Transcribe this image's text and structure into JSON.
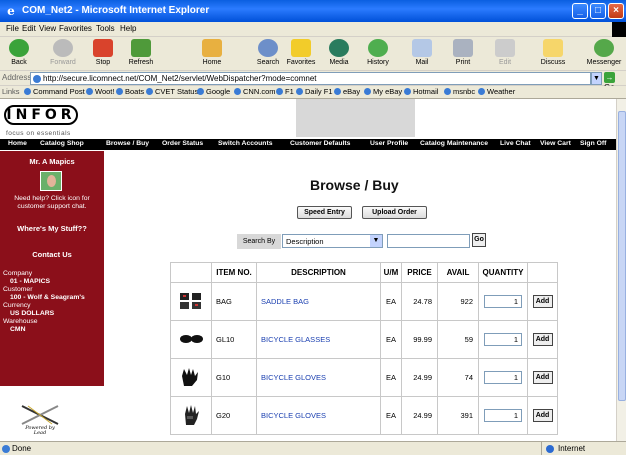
{
  "window": {
    "title": "COM_Net2 - Microsoft Internet Explorer"
  },
  "menu": [
    "File",
    "Edit",
    "View",
    "Favorites",
    "Tools",
    "Help"
  ],
  "toolbar": {
    "back": "Back",
    "forward": "Forward",
    "stop": "Stop",
    "refresh": "Refresh",
    "home": "Home",
    "search": "Search",
    "favorites": "Favorites",
    "media": "Media",
    "history": "History",
    "mail": "Mail",
    "print": "Print",
    "edit": "Edit",
    "discuss": "Discuss",
    "messenger": "Messenger"
  },
  "address": {
    "label": "Address",
    "url": "http://secure.licomnect.net/COM_Net2/servlet/WebDispatcher?mode=comnet",
    "go": "Go"
  },
  "links": {
    "label": "Links",
    "items": [
      "Command Post",
      "Woot!",
      "Boats",
      "CVET Status",
      "Google",
      "CNN.com",
      "F1",
      "Daily F1",
      "eBay",
      "My eBay",
      "Hotmail",
      "msnbc",
      "Weather"
    ]
  },
  "header": {
    "logo": "INFOR",
    "tagline": "focus on essentials",
    "nav": [
      "Home",
      "Catalog Shop",
      "Browse / Buy",
      "Order Status",
      "Switch Accounts",
      "Customer Defaults",
      "User Profile",
      "Catalog Maintenance",
      "Live Chat",
      "View Cart",
      "Sign Off"
    ]
  },
  "sidebar": {
    "user": "Mr. A Mapics",
    "help": "Need help? Click icon for customer support chat.",
    "wheres_stuff": "Where's My Stuff??",
    "contact": "Contact Us",
    "company_label": "Company",
    "company_value": "01 - MAPICS",
    "customer_label": "Customer",
    "customer_value": "100 - Wolf & Seagram's",
    "currency_label": "Currency",
    "currency_value": "US DOLLARS",
    "warehouse_label": "Warehouse",
    "warehouse_value": "CMN",
    "lead_caption": "Powered by Lead"
  },
  "main": {
    "heading": "Browse / Buy",
    "speed_entry": "Speed Entry",
    "upload_order": "Upload Order",
    "search_by_label": "Search By",
    "search_by_value": "Description",
    "search_input_value": "",
    "go": "Go"
  },
  "table": {
    "headers": [
      "ITEM NO.",
      "DESCRIPTION",
      "U/M",
      "PRICE",
      "AVAIL",
      "QUANTITY"
    ],
    "add_label": "Add",
    "rows": [
      {
        "item": "BAG",
        "desc": "SADDLE BAG",
        "um": "EA",
        "price": "24.78",
        "avail": "922",
        "qty": "1",
        "icon": "saddle-bag-icon"
      },
      {
        "item": "GL10",
        "desc": "BICYCLE GLASSES",
        "um": "EA",
        "price": "99.99",
        "avail": "59",
        "qty": "1",
        "icon": "glasses-icon"
      },
      {
        "item": "G10",
        "desc": "BICYCLE GLOVES",
        "um": "EA",
        "price": "24.99",
        "avail": "74",
        "qty": "1",
        "icon": "gloves-icon"
      },
      {
        "item": "G20",
        "desc": "BICYCLE GLOVES",
        "um": "EA",
        "price": "24.99",
        "avail": "391",
        "qty": "1",
        "icon": "gloves-icon"
      }
    ]
  },
  "status": {
    "left": "Done",
    "zone": "Internet"
  },
  "colors": {
    "sidebar": "#8b0f1a",
    "navbar": "#000000",
    "link": "#1a3fb0",
    "titlebar": "#0a5fe0"
  }
}
